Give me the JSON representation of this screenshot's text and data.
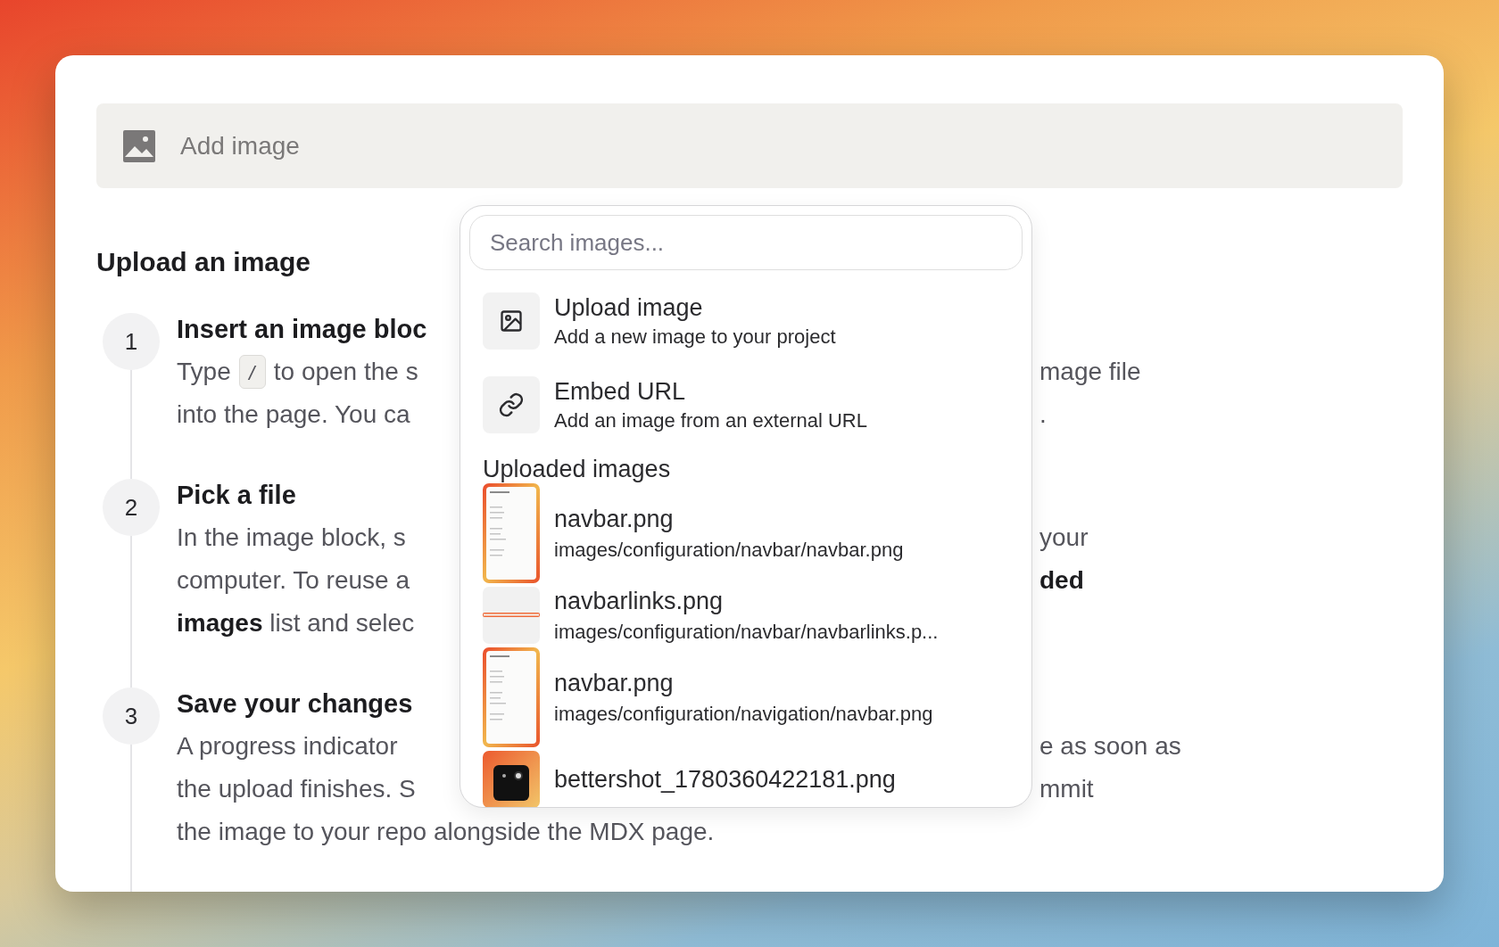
{
  "add_image_bar": {
    "label": "Add image"
  },
  "section_title": "Upload an image",
  "steps": [
    {
      "number": "1",
      "title": "Insert an image bloc",
      "lines": [
        {
          "left": "Type",
          "key": "/",
          "left_rest": "to open the s",
          "right": "mage file"
        },
        {
          "left": "into the page. You ca",
          "right": "."
        }
      ]
    },
    {
      "number": "2",
      "title": "Pick a file",
      "lines": [
        {
          "left": "In the image block, s",
          "right": "your"
        },
        {
          "left": "computer. To reuse a",
          "right": "**ded**"
        },
        {
          "left": "**images** list and selec"
        }
      ]
    },
    {
      "number": "3",
      "title": "Save your changes",
      "lines": [
        {
          "left": "A progress indicator",
          "right": "e as soon as"
        },
        {
          "left": "the upload finishes. S",
          "right": "mmit"
        },
        {
          "left": "the image to your repo alongside the MDX page."
        }
      ]
    }
  ],
  "popup": {
    "search": {
      "placeholder": "Search images..."
    },
    "actions": [
      {
        "kind": "upload",
        "title": "Upload image",
        "subtitle": "Add a new image to your project"
      },
      {
        "kind": "link",
        "title": "Embed URL",
        "subtitle": "Add an image from an external URL"
      }
    ],
    "section_title": "Uploaded images",
    "images": [
      {
        "kind": "tall",
        "name": "navbar.png",
        "path": "images/configuration/navbar/navbar.png"
      },
      {
        "kind": "strip",
        "name": "navbarlinks.png",
        "path": "images/configuration/navbar/navbarlinks.p..."
      },
      {
        "kind": "tall",
        "name": "navbar.png",
        "path": "images/configuration/navigation/navbar.png"
      },
      {
        "kind": "dark",
        "name": "bettershot_1780360422181.png"
      }
    ]
  }
}
